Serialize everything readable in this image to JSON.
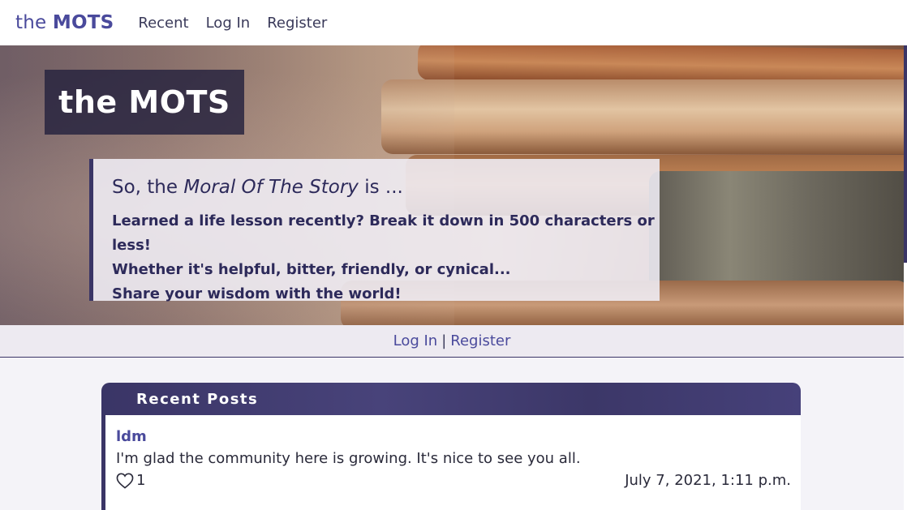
{
  "nav": {
    "brand_prefix": "the",
    "brand_bold": "MOTS",
    "links": [
      "Recent",
      "Log In",
      "Register"
    ]
  },
  "hero": {
    "title": "the MOTS",
    "quote_prefix": "So, the",
    "quote_emphasis": "Moral Of The Story",
    "quote_suffix": "is ...",
    "lines": [
      "Learned a life lesson recently? Break it down in 500 characters or less!",
      "Whether it's helpful, bitter, friendly, or cynical...",
      "Share your wisdom with the world!"
    ]
  },
  "auth": {
    "login": "Log In",
    "separator": "|",
    "register": "Register"
  },
  "recent_posts": {
    "heading": "Recent Posts",
    "posts": [
      {
        "user": "ldm",
        "text": "I'm glad the community here is growing. It's nice to see you all.",
        "likes": "1",
        "date": "July 7, 2021, 1:11 p.m."
      }
    ]
  },
  "colors": {
    "accent": "#3a3566",
    "link": "#4a4a9c"
  },
  "icons": {
    "like": "heart-outline-icon"
  }
}
